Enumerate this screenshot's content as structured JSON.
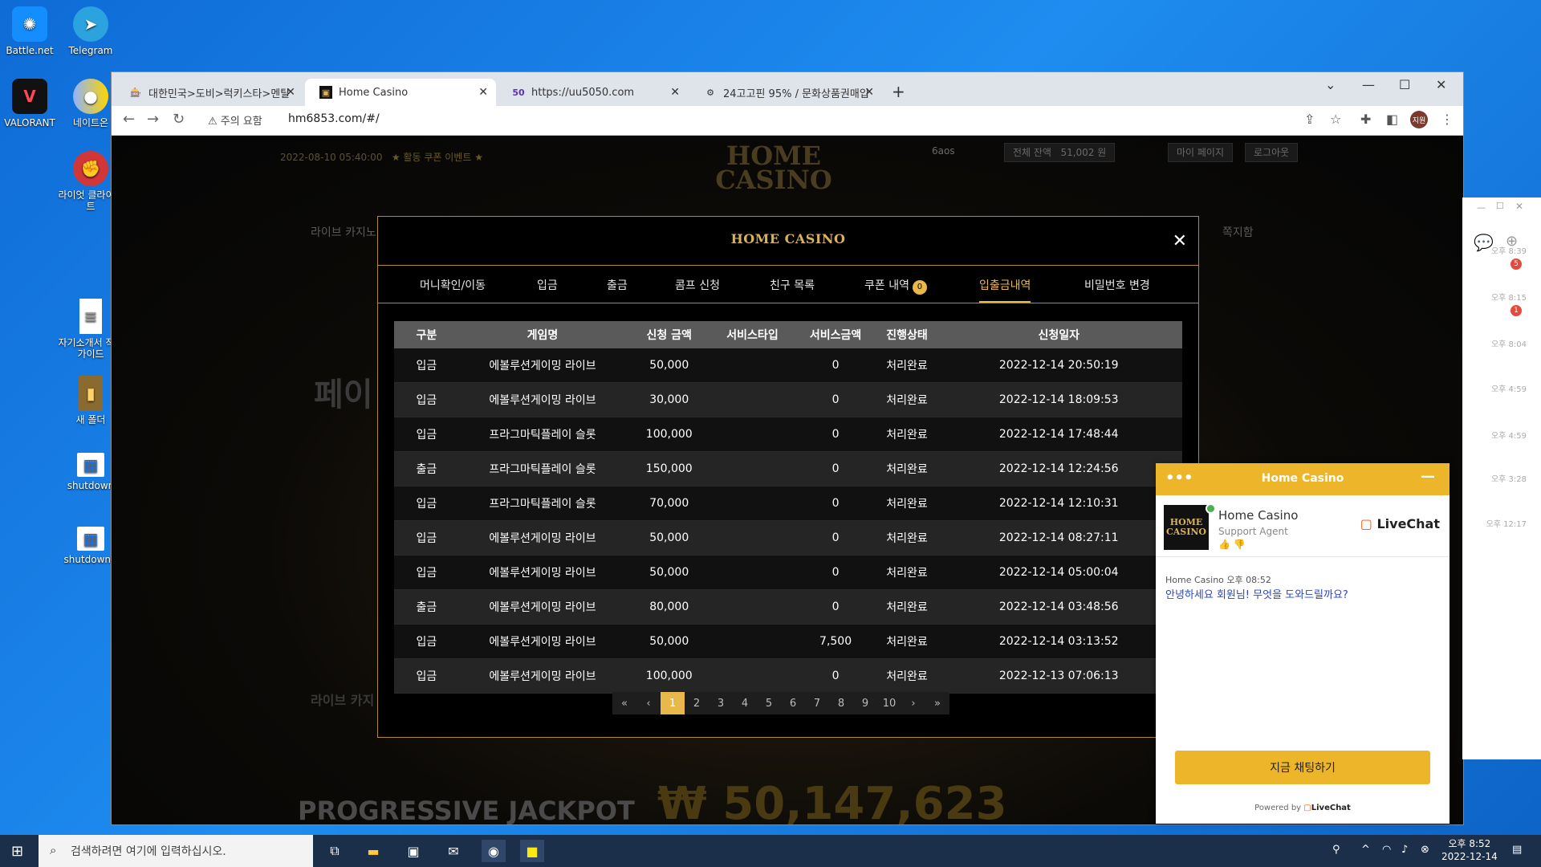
{
  "desktop": {
    "icons": [
      {
        "label": "Battle.net"
      },
      {
        "label": "Telegram"
      },
      {
        "label": "VALORANT"
      },
      {
        "label": "네이트온"
      },
      {
        "label": "라이엇 클라이언트"
      },
      {
        "label": "자기소개서 작성 가이드"
      },
      {
        "label": "새 폴더"
      },
      {
        "label": "shutdown"
      },
      {
        "label": "shutdown ("
      }
    ]
  },
  "browser": {
    "tabs": [
      {
        "title": "대한민국>도비>럭키스타>멘탈",
        "icon": "🎰"
      },
      {
        "title": "Home Casino",
        "icon": "▣"
      },
      {
        "title": "https://uu5050.com",
        "icon": "50"
      },
      {
        "title": "24고고핀 95% / 문화상품권매입",
        "icon": "⚙"
      }
    ],
    "security_label": "주의 요함",
    "url": "hm6853.com/#/",
    "profile": "지원"
  },
  "site": {
    "date": "2022-08-10 05:40:00",
    "event": "★ 활동 쿠폰 이벤트 ★",
    "user": "6aos",
    "balance_label": "전체 잔액",
    "balance": "51,002 원",
    "mypage": "마이 페이지",
    "logout": "로그아웃",
    "logo": "HOME CASINO",
    "nav_live": "라이브 카지노",
    "nav_msg": "쪽지함",
    "bg_promo": "페이",
    "bg_live": "라이브 카지",
    "jackpot_label": "PROGRESSIVE JACKPOT",
    "jackpot_value": "₩ 50,147,623"
  },
  "modal": {
    "logo": "HOME CASINO",
    "tabs": [
      {
        "label": "머니확인/이동"
      },
      {
        "label": "입금"
      },
      {
        "label": "출금"
      },
      {
        "label": "콤프 신청"
      },
      {
        "label": "친구 목록"
      },
      {
        "label": "쿠폰 내역",
        "badge": "0"
      },
      {
        "label": "입출금내역"
      },
      {
        "label": "비밀번호 변경"
      }
    ],
    "columns": [
      "구분",
      "게임명",
      "신청 금액",
      "서비스타입",
      "서비스금액",
      "진행상태",
      "신청일자"
    ],
    "rows": [
      [
        "입금",
        "에볼루션게이밍 라이브",
        "50,000",
        "",
        "0",
        "처리완료",
        "2022-12-14 20:50:19"
      ],
      [
        "입금",
        "에볼루션게이밍 라이브",
        "30,000",
        "",
        "0",
        "처리완료",
        "2022-12-14 18:09:53"
      ],
      [
        "입금",
        "프라그마틱플레이 슬롯",
        "100,000",
        "",
        "0",
        "처리완료",
        "2022-12-14 17:48:44"
      ],
      [
        "출금",
        "프라그마틱플레이 슬롯",
        "150,000",
        "",
        "0",
        "처리완료",
        "2022-12-14 12:24:56"
      ],
      [
        "입금",
        "프라그마틱플레이 슬롯",
        "70,000",
        "",
        "0",
        "처리완료",
        "2022-12-14 12:10:31"
      ],
      [
        "입금",
        "에볼루션게이밍 라이브",
        "50,000",
        "",
        "0",
        "처리완료",
        "2022-12-14 08:27:11"
      ],
      [
        "입금",
        "에볼루션게이밍 라이브",
        "50,000",
        "",
        "0",
        "처리완료",
        "2022-12-14 05:00:04"
      ],
      [
        "출금",
        "에볼루션게이밍 라이브",
        "80,000",
        "",
        "0",
        "처리완료",
        "2022-12-14 03:48:56"
      ],
      [
        "입금",
        "에볼루션게이밍 라이브",
        "50,000",
        "",
        "7,500",
        "처리완료",
        "2022-12-14 03:13:52"
      ],
      [
        "입금",
        "에볼루션게이밍 라이브",
        "100,000",
        "",
        "0",
        "처리완료",
        "2022-12-13 07:06:13"
      ]
    ],
    "pager": [
      "«",
      "‹",
      "1",
      "2",
      "3",
      "4",
      "5",
      "6",
      "7",
      "8",
      "9",
      "10",
      "›",
      "»"
    ],
    "current_page": "1"
  },
  "livechat": {
    "header": "Home Casino",
    "agent_name": "Home Casino",
    "agent_role": "Support Agent",
    "brand": "LiveChat",
    "msg_meta": "Home Casino 오후 08:52",
    "msg": "안녕하세요 회원님! 무엇을 도와드릴까요?",
    "button": "지금 채팅하기",
    "powered": "Powered by",
    "avatar_text": "HOME CASINO"
  },
  "sidepanel": {
    "items": [
      {
        "time": "오후 8:39",
        "badge": "5"
      },
      {
        "time": "오후 8:15",
        "badge": "1"
      },
      {
        "time": "오후 8:04"
      },
      {
        "time": "오후 4:59"
      },
      {
        "time": "오후 4:59"
      },
      {
        "time": "오후 3:28"
      },
      {
        "time": "오후 12:17"
      }
    ]
  },
  "taskbar": {
    "search_placeholder": "검색하려면 여기에 입력하십시오.",
    "time": "오후 8:52",
    "date": "2022-12-14"
  }
}
